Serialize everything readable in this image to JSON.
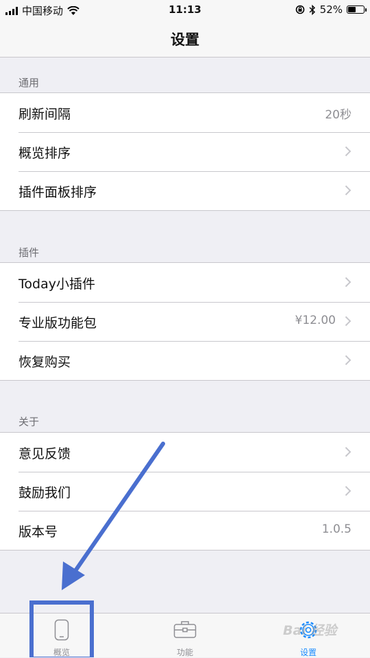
{
  "status_bar": {
    "carrier": "中国移动",
    "time": "11:13",
    "battery_text": "52%",
    "battery_level": 0.52,
    "icons": [
      "signal-icon",
      "wifi-icon",
      "orientation-lock-icon",
      "bluetooth-icon",
      "battery-icon"
    ]
  },
  "nav": {
    "title": "设置"
  },
  "sections": [
    {
      "header": "通用",
      "rows": [
        {
          "label": "刷新间隔",
          "value": "20秒"
        },
        {
          "label": "概览排序"
        },
        {
          "label": "插件面板排序"
        }
      ]
    },
    {
      "header": "插件",
      "rows": [
        {
          "label": "Today小插件"
        },
        {
          "label": "专业版功能包",
          "value": "¥12.00"
        },
        {
          "label": "恢复购买"
        }
      ]
    },
    {
      "header": "关于",
      "rows": [
        {
          "label": "意见反馈"
        },
        {
          "label": "鼓励我们"
        },
        {
          "label": "版本号",
          "value": "1.0.5"
        }
      ]
    }
  ],
  "tab_bar": {
    "tabs": [
      {
        "label": "概览",
        "icon": "phone-icon"
      },
      {
        "label": "功能",
        "icon": "toolbox-icon"
      },
      {
        "label": "设置",
        "icon": "gear-icon",
        "active": true
      }
    ],
    "active_color": "#1a8cff",
    "inactive_color": "#8e8e93"
  },
  "annotation": {
    "color": "#4a6fcf",
    "watermark": "Bai 经验"
  }
}
